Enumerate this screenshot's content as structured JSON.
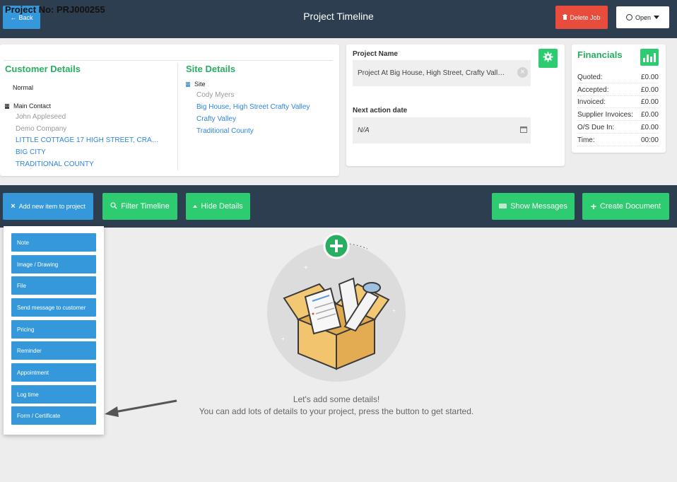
{
  "header": {
    "back_label": "Back",
    "title": "Project Timeline",
    "delete_label": "Delete Job",
    "status_label": "Open"
  },
  "project": {
    "number_label": "Project No: PRJ000255",
    "customer": {
      "title": "Customer Details",
      "type": "Normal",
      "contact_heading": "Main Contact",
      "name": "John Appleseed",
      "company": "Demo Company",
      "address1": "LITTLE COTTAGE 17 HIGH STREET, CRA…",
      "address2": "BIG CITY",
      "address3": "TRADITIONAL COUNTY"
    },
    "site": {
      "title": "Site Details",
      "heading": "Site",
      "contact": "Cody Myers",
      "address1": "Big House, High Street Crafty Valley",
      "address2": "Crafty Valley",
      "address3": "Traditional County"
    }
  },
  "details": {
    "project_name_label": "Project Name",
    "project_name_value": "Project At Big House, High Street, Crafty Vall…",
    "next_action_label": "Next action date",
    "next_action_value": "N/A"
  },
  "financials": {
    "title": "Financials",
    "rows": [
      {
        "label": "Quoted:",
        "value": "£0.00"
      },
      {
        "label": "Accepted:",
        "value": "£0.00"
      },
      {
        "label": "Invoiced:",
        "value": "£0.00"
      },
      {
        "label": "Supplier Invoices:",
        "value": "£0.00"
      },
      {
        "label": "O/S Due In:",
        "value": "£0.00"
      },
      {
        "label": "Time:",
        "value": "00:00"
      }
    ]
  },
  "toolbar": {
    "add_label": "Add new item to project",
    "filter_label": "Filter Timeline",
    "hide_label": "Hide Details",
    "messages_label": "Show Messages",
    "create_doc_label": "Create Document"
  },
  "add_menu": {
    "items": [
      "Note",
      "Image / Drawing",
      "File",
      "Send message to customer",
      "Pricing",
      "Reminder",
      "Appointment",
      "Log time",
      "Form / Certificate"
    ]
  },
  "empty_state": {
    "line1": "Let's add some details!",
    "line2": "You can add lots of details to your project, press the button to get started."
  },
  "colors": {
    "navy": "#2d3e50",
    "blue": "#3498db",
    "green": "#2ecc71",
    "red": "#e74c3c"
  }
}
